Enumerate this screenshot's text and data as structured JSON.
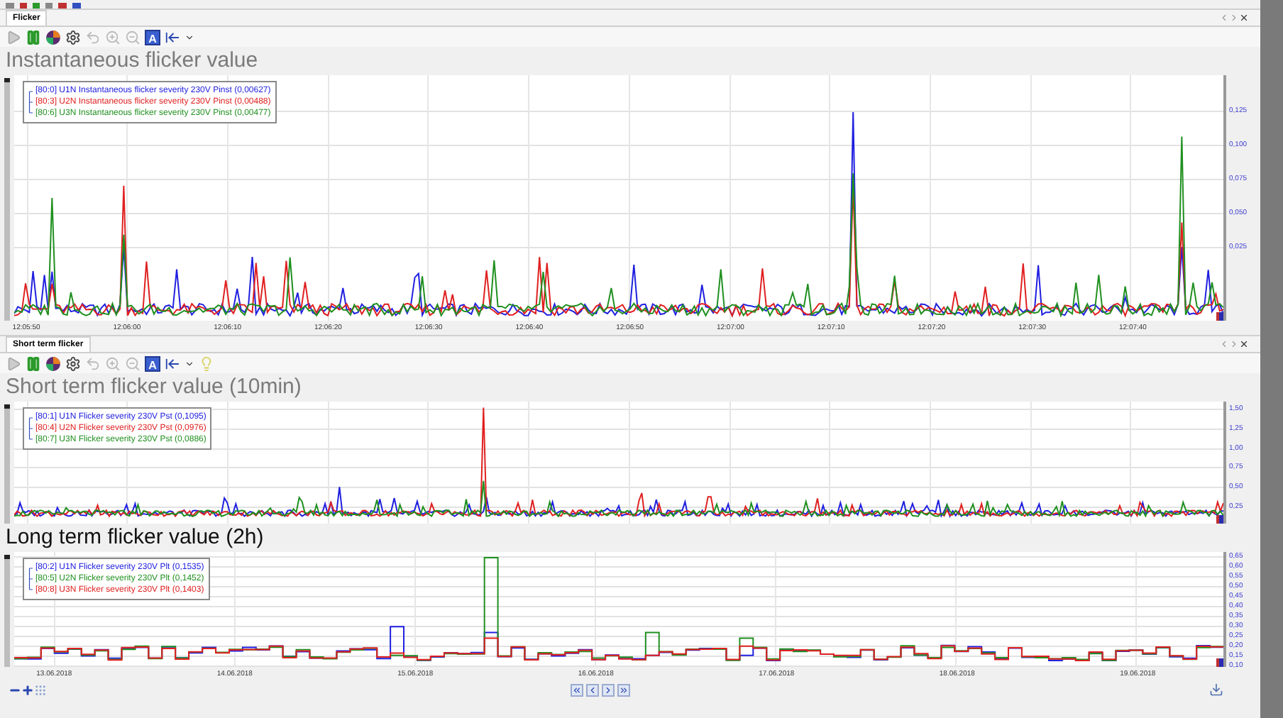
{
  "panels": [
    {
      "tab": {
        "label": "Flicker",
        "selected": true
      },
      "toolbar": {
        "font_label": "A",
        "show_note": false
      },
      "charts": [
        {
          "kind": "spikes",
          "title": "Instantaneous flicker value",
          "active": false,
          "legend": [
            {
              "text": "[80:0] U1N Instantaneous flicker severity 230V Pinst (0,00627)",
              "color": "#2020e0"
            },
            {
              "text": "[80:3] U2N Instantaneous flicker severity 230V Pinst (0,00488)",
              "color": "#e02020"
            },
            {
              "text": "[80:6] U3N Instantaneous flicker severity 230V Pinst (0,00477)",
              "color": "#209020"
            }
          ],
          "y_labels": [
            "0,125",
            "0,100",
            "0,075",
            "0,050",
            "0,025"
          ],
          "x_labels": [
            "12:05:50",
            "12:06:00",
            "12:06:10",
            "12:06:20",
            "12:06:30",
            "12:06:40",
            "12:06:50",
            "12:07:00",
            "12:07:10",
            "12:07:20",
            "12:07:30",
            "12:07:40"
          ]
        }
      ]
    },
    {
      "tab": {
        "label": "Short term flicker",
        "selected": true
      },
      "toolbar": {
        "font_label": "A",
        "show_note": true
      },
      "charts": [
        {
          "kind": "noise",
          "title": "Short term flicker value (10min)",
          "active": false,
          "legend": [
            {
              "text": "[80:1] U1N Flicker severity 230V Pst (0,1095)",
              "color": "#2020e0"
            },
            {
              "text": "[80:4] U2N Flicker severity 230V Pst (0,0976)",
              "color": "#e02020"
            },
            {
              "text": "[80:7] U3N Flicker severity 230V Pst (0,0886)",
              "color": "#209020"
            }
          ],
          "y_labels": [
            "1,50",
            "1,25",
            "1,00",
            "0,75",
            "0,50",
            "0,25"
          ]
        },
        {
          "kind": "steps",
          "title": "Long term flicker value (2h)",
          "active": true,
          "legend": [
            {
              "text": "[80:2] U1N Flicker severity 230V Plt (0,1535)",
              "color": "#2020e0"
            },
            {
              "text": "[80:5] U2N Flicker severity 230V Plt (0,1452)",
              "color": "#209020"
            },
            {
              "text": "[80:8] U3N Flicker severity 230V Plt (0,1403)",
              "color": "#e02020"
            }
          ],
          "y_labels": [
            "0,65",
            "0,60",
            "0,55",
            "0,50",
            "0,45",
            "0,40",
            "0,35",
            "0,30",
            "0,25",
            "0,20",
            "0,15",
            "0,10"
          ],
          "x_labels": [
            "13.06.2018",
            "14.06.2018",
            "15.06.2018",
            "16.06.2018",
            "17.06.2018",
            "18.06.2018",
            "19.06.2018"
          ]
        }
      ]
    }
  ]
}
